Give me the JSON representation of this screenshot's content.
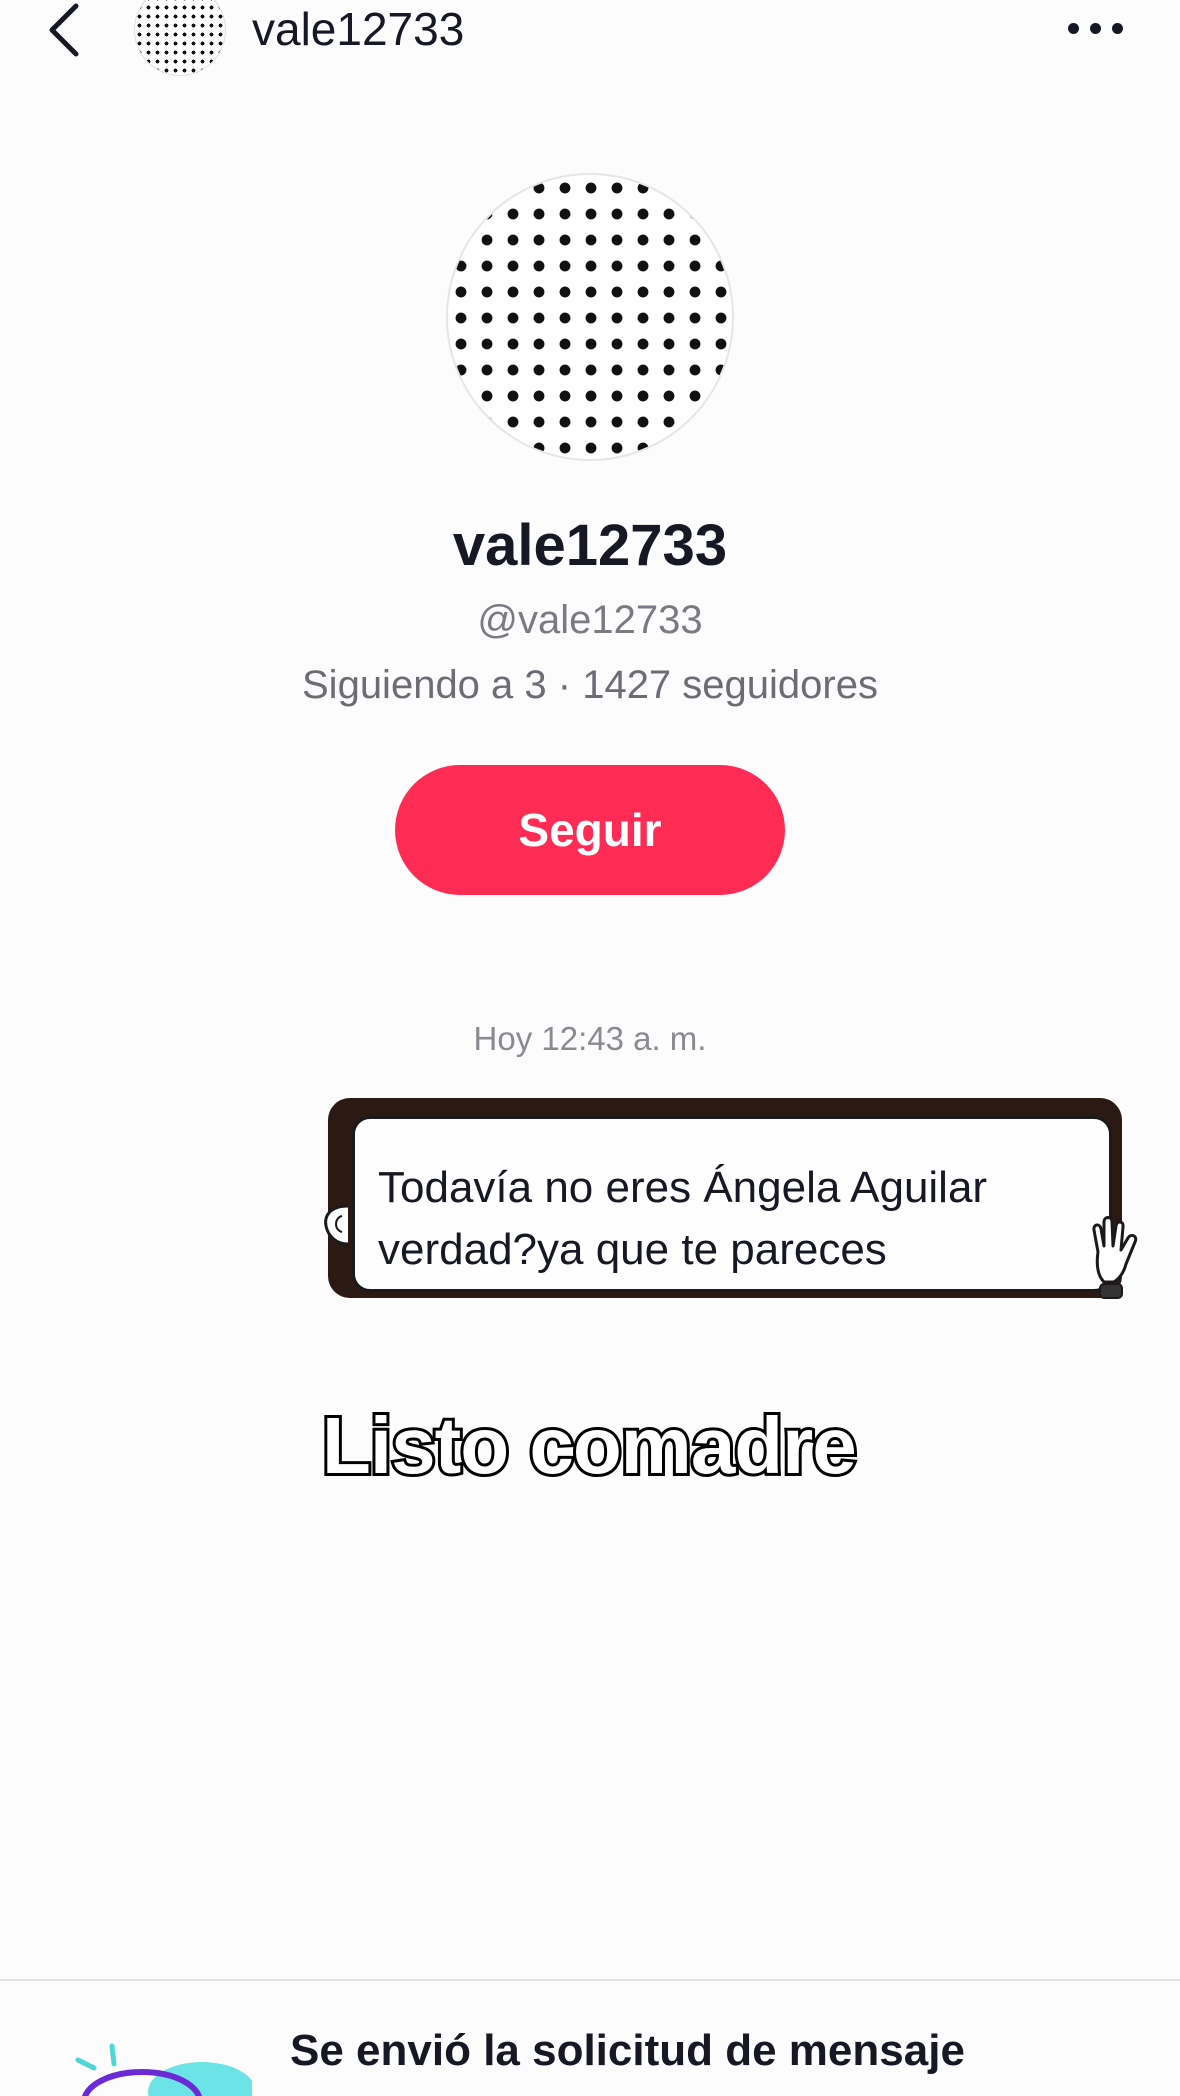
{
  "header": {
    "back_icon": "chevron-left-icon",
    "username": "vale12733",
    "more_icon": "more-horizontal-icon"
  },
  "profile": {
    "name": "vale12733",
    "handle": "@vale12733",
    "stats": "Siguiendo a 3 · 1427 seguidores",
    "follow_label": "Seguir"
  },
  "chat": {
    "timestamp": "Hoy 12:43 a. m.",
    "messages": [
      {
        "text_line1": "Todavía no eres Ángela Aguilar",
        "text_line2": "verdad?ya que te pareces"
      }
    ]
  },
  "overlay": {
    "caption": "Listo comadre"
  },
  "footer": {
    "request_title": "Se envió la solicitud de mensaje"
  },
  "colors": {
    "accent": "#fe2c55",
    "background": "#fcfcfd",
    "text": "#161823",
    "secondary_text": "#7a7b82"
  }
}
